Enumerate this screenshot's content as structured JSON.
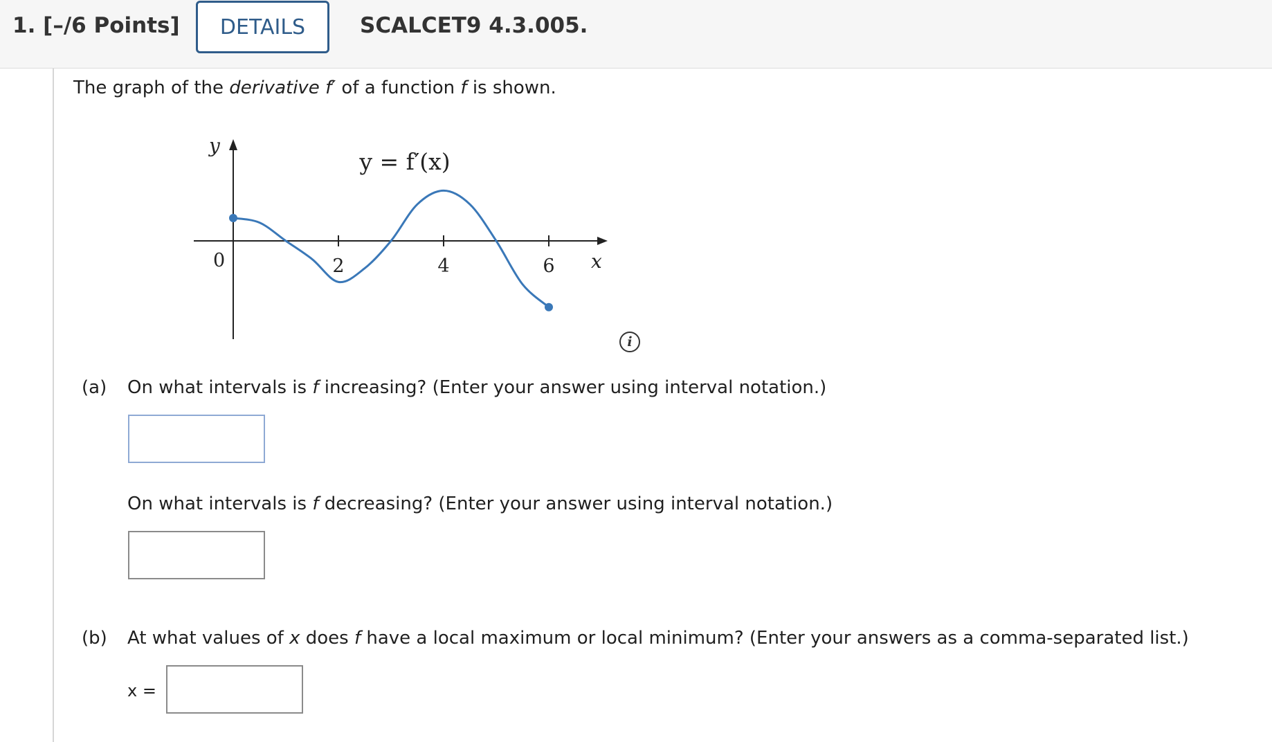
{
  "header": {
    "question_number": "1.",
    "points": "[–/6 Points]",
    "details_label": "DETAILS",
    "assignment_code": "SCALCET9 4.3.005."
  },
  "prompt": {
    "intro_prefix": "The graph of the ",
    "intro_italic": "derivative",
    "intro_fprime": " f′",
    "intro_middle": " of a function ",
    "intro_f": "f",
    "intro_suffix": " is shown."
  },
  "graph": {
    "curve_label": "y = f′(x)",
    "y_axis_label": "y",
    "x_axis_label": "x",
    "origin_label": "0",
    "tick_labels": [
      "2",
      "4",
      "6"
    ],
    "curve_color": "#3a78b8",
    "info_icon_glyph": "i"
  },
  "chart_data": {
    "type": "line",
    "title": "y = f′(x)",
    "xlabel": "x",
    "ylabel": "y",
    "xlim": [
      0,
      7
    ],
    "x_ticks": [
      0,
      2,
      4,
      6
    ],
    "grid": false,
    "series": [
      {
        "name": "y = f′(x)",
        "x": [
          0,
          0.5,
          1,
          1.5,
          2,
          2.5,
          3,
          3.5,
          4,
          4.5,
          5,
          5.5,
          6
        ],
        "y": [
          1.0,
          0.8,
          0.0,
          -0.8,
          -1.8,
          -1.2,
          0.0,
          1.6,
          2.2,
          1.6,
          0.0,
          -1.9,
          -2.9
        ]
      }
    ],
    "endpoints": [
      {
        "x": 0,
        "y": 1.0
      },
      {
        "x": 6,
        "y": -2.9
      }
    ]
  },
  "part_a": {
    "label": "(a)",
    "q1_prefix": "On what intervals is ",
    "q1_f": "f",
    "q1_suffix": " increasing? (Enter your answer using interval notation.)",
    "q2_prefix": "On what intervals is ",
    "q2_f": "f",
    "q2_suffix": " decreasing? (Enter your answer using interval notation.)",
    "answer1": "",
    "answer2": ""
  },
  "part_b": {
    "label": "(b)",
    "q_prefix": "At what values of ",
    "q_x": "x",
    "q_middle": " does ",
    "q_f": "f",
    "q_suffix": " have a local maximum or local minimum? (Enter your answers as a comma-separated list.)",
    "x_label": "x =",
    "answer": ""
  }
}
